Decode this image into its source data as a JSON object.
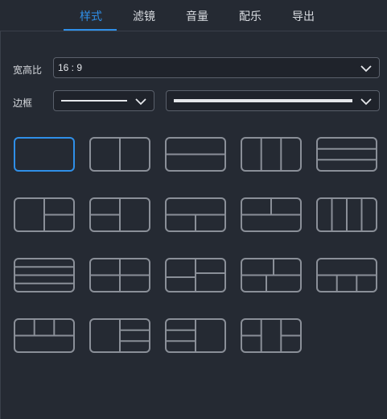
{
  "tabs": [
    {
      "label": "样式",
      "active": true
    },
    {
      "label": "滤镜",
      "active": false
    },
    {
      "label": "音量",
      "active": false
    },
    {
      "label": "配乐",
      "active": false
    },
    {
      "label": "导出",
      "active": false
    }
  ],
  "aspect_ratio": {
    "label": "宽高比",
    "value": "16 : 9"
  },
  "border": {
    "label": "边框",
    "style_value": "thin-line",
    "width_value": "thick-line"
  },
  "layouts": [
    {
      "name": "single",
      "selected": true
    },
    {
      "name": "2-columns",
      "selected": false
    },
    {
      "name": "2-rows",
      "selected": false
    },
    {
      "name": "3-columns",
      "selected": false
    },
    {
      "name": "3-rows",
      "selected": false
    },
    {
      "name": "left-1-right-2",
      "selected": false
    },
    {
      "name": "left-2-right-1",
      "selected": false
    },
    {
      "name": "top-1-bottom-2",
      "selected": false
    },
    {
      "name": "top-2-bottom-1",
      "selected": false
    },
    {
      "name": "4-columns",
      "selected": false
    },
    {
      "name": "4-rows",
      "selected": false
    },
    {
      "name": "2x2-grid",
      "selected": false
    },
    {
      "name": "left-2-right-2-offset",
      "selected": false
    },
    {
      "name": "top-2-bottom-3",
      "selected": false
    },
    {
      "name": "top-1-bottom-3",
      "selected": false
    },
    {
      "name": "top-3-bottom-1",
      "selected": false
    },
    {
      "name": "left-1-right-3",
      "selected": false
    },
    {
      "name": "left-3-right-1",
      "selected": false
    },
    {
      "name": "mixed-6-cell",
      "selected": false
    }
  ],
  "colors": {
    "background": "#252a33",
    "accent": "#2f8fe8",
    "tile_stroke": "#8a8f98",
    "tile_selected_stroke": "#2f8fe8"
  }
}
